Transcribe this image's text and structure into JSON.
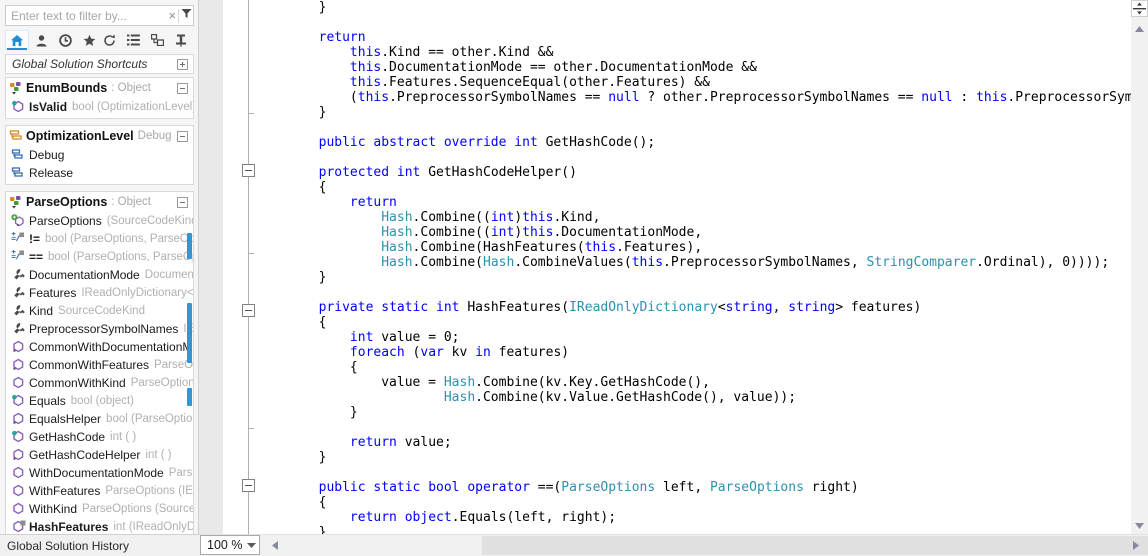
{
  "sidebar": {
    "filter": {
      "placeholder": "Enter text to filter by...",
      "value": "",
      "clear_glyph": "×"
    },
    "toolbar_left": [
      {
        "name": "home-icon",
        "label": "Home",
        "selected": true
      },
      {
        "name": "person-icon",
        "label": "Members",
        "selected": false
      },
      {
        "name": "clock-icon",
        "label": "Recent",
        "selected": false
      },
      {
        "name": "star-icon",
        "label": "Favorites",
        "selected": false
      }
    ],
    "toolbar_right": [
      {
        "name": "refresh-icon",
        "label": "Refresh"
      },
      {
        "name": "list-icon",
        "label": "List view"
      },
      {
        "name": "group-icon",
        "label": "Group by"
      },
      {
        "name": "pin-icon",
        "label": "Pin"
      }
    ],
    "section_header": {
      "title": "Global Solution Shortcuts",
      "expander": "plus"
    },
    "groups": [
      {
        "name": "EnumBounds",
        "type": ": Object",
        "icon": "enum-group-icon",
        "expander": "minus",
        "members": [
          {
            "icon": "method-key-icon",
            "name": "IsValid",
            "signature": "bool (OptimizationLevel)",
            "bold": true
          }
        ]
      },
      {
        "name": "OptimizationLevel",
        "type": "Debug",
        "icon": "enum-icon",
        "expander": "minus",
        "members": [
          {
            "icon": "enum-member-icon",
            "name": "Debug",
            "signature": "",
            "bold": false
          },
          {
            "icon": "enum-member-icon",
            "name": "Release",
            "signature": "",
            "bold": false
          }
        ]
      },
      {
        "name": "ParseOptions",
        "type": ": Object",
        "icon": "class-group-icon",
        "expander": "minus",
        "members": [
          {
            "icon": "ctor-icon",
            "name": "ParseOptions",
            "signature": "(SourceCodeKind, D",
            "bold": false
          },
          {
            "icon": "operator-icon",
            "name": "!=",
            "signature": "bool (ParseOptions, ParseOptions",
            "bold": true
          },
          {
            "icon": "operator-icon",
            "name": "==",
            "signature": "bool (ParseOptions, ParseOption",
            "bold": true
          },
          {
            "icon": "property-icon",
            "name": "DocumentationMode",
            "signature": "Document",
            "bold": false
          },
          {
            "icon": "property-icon",
            "name": "Features",
            "signature": "IReadOnlyDictionary<strin",
            "bold": false
          },
          {
            "icon": "property-icon",
            "name": "Kind",
            "signature": "SourceCodeKind",
            "bold": false
          },
          {
            "icon": "property-icon",
            "name": "PreprocessorSymbolNames",
            "signature": "IEnu",
            "bold": false
          },
          {
            "icon": "method-abstract-icon",
            "name": "CommonWithDocumentationM",
            "signature": "",
            "bold": false
          },
          {
            "icon": "method-abstract-icon",
            "name": "CommonWithFeatures",
            "signature": "ParseOpti",
            "bold": false
          },
          {
            "icon": "method-icon",
            "name": "CommonWithKind",
            "signature": "ParseOptions",
            "bold": false
          },
          {
            "icon": "method-key-icon",
            "name": "Equals",
            "signature": "bool (object)",
            "bold": false
          },
          {
            "icon": "method-abstract-icon",
            "name": "EqualsHelper",
            "signature": "bool (ParseOptions)",
            "bold": false
          },
          {
            "icon": "method-key-icon",
            "name": "GetHashCode",
            "signature": "int ( )",
            "bold": false
          },
          {
            "icon": "method-abstract-icon",
            "name": "GetHashCodeHelper",
            "signature": "int ( )",
            "bold": false
          },
          {
            "icon": "method-icon",
            "name": "WithDocumentationMode",
            "signature": "Parse",
            "bold": false
          },
          {
            "icon": "method-icon",
            "name": "WithFeatures",
            "signature": "ParseOptions (IEnum",
            "bold": false
          },
          {
            "icon": "method-icon",
            "name": "WithKind",
            "signature": "ParseOptions (SourceCod",
            "bold": false
          },
          {
            "icon": "method-static-icon",
            "name": "HashFeatures",
            "signature": "int (IReadOnlyDictio",
            "bold": true
          }
        ]
      }
    ],
    "status": "Global Solution History"
  },
  "editor": {
    "zoom": {
      "value": "100 %",
      "chevron": "▼"
    },
    "split_icon": "split-view-icon",
    "scroll_up_icon": "scroll-up-arrow-icon",
    "scroll_down_icon": "scroll-down-arrow-icon",
    "scroll_left_icon": "scroll-left-arrow-icon",
    "scroll_right_icon": "scroll-right-arrow-icon",
    "colors": {
      "keyword": "#0000ff",
      "type": "#2b91af",
      "text": "#000000",
      "accent": "#2f96dc"
    },
    "fold_boxes_y": [
      164,
      304,
      479
    ],
    "fold_ticks_y": [
      113,
      253,
      428
    ],
    "lines": [
      [
        {
          "t": "        }",
          "c": "op"
        }
      ],
      [],
      [
        {
          "t": "        ",
          "c": "op"
        },
        {
          "t": "return",
          "c": "kw"
        }
      ],
      [
        {
          "t": "            ",
          "c": "op"
        },
        {
          "t": "this",
          "c": "kw"
        },
        {
          "t": ".Kind == other.Kind &&",
          "c": "op"
        }
      ],
      [
        {
          "t": "            ",
          "c": "op"
        },
        {
          "t": "this",
          "c": "kw"
        },
        {
          "t": ".DocumentationMode == other.DocumentationMode &&",
          "c": "op"
        }
      ],
      [
        {
          "t": "            ",
          "c": "op"
        },
        {
          "t": "this",
          "c": "kw"
        },
        {
          "t": ".Features.SequenceEqual(other.Features) &&",
          "c": "op"
        }
      ],
      [
        {
          "t": "            (",
          "c": "op"
        },
        {
          "t": "this",
          "c": "kw"
        },
        {
          "t": ".PreprocessorSymbolNames == ",
          "c": "op"
        },
        {
          "t": "null",
          "c": "kw"
        },
        {
          "t": " ? other.PreprocessorSymbolNames == ",
          "c": "op"
        },
        {
          "t": "null",
          "c": "kw"
        },
        {
          "t": " : ",
          "c": "op"
        },
        {
          "t": "this",
          "c": "kw"
        },
        {
          "t": ".PreprocessorSymbolNames",
          "c": "op"
        }
      ],
      [
        {
          "t": "        }",
          "c": "op"
        }
      ],
      [],
      [
        {
          "t": "        ",
          "c": "op"
        },
        {
          "t": "public abstract override int",
          "c": "kw"
        },
        {
          "t": " GetHashCode();",
          "c": "op"
        }
      ],
      [],
      [
        {
          "t": "        ",
          "c": "op"
        },
        {
          "t": "protected int",
          "c": "kw"
        },
        {
          "t": " GetHashCodeHelper()",
          "c": "op"
        }
      ],
      [
        {
          "t": "        {",
          "c": "op"
        }
      ],
      [
        {
          "t": "            ",
          "c": "op"
        },
        {
          "t": "return",
          "c": "kw"
        }
      ],
      [
        {
          "t": "                ",
          "c": "op"
        },
        {
          "t": "Hash",
          "c": "ty"
        },
        {
          "t": ".Combine((",
          "c": "op"
        },
        {
          "t": "int",
          "c": "kw"
        },
        {
          "t": ")",
          "c": "op"
        },
        {
          "t": "this",
          "c": "kw"
        },
        {
          "t": ".Kind,",
          "c": "op"
        }
      ],
      [
        {
          "t": "                ",
          "c": "op"
        },
        {
          "t": "Hash",
          "c": "ty"
        },
        {
          "t": ".Combine((",
          "c": "op"
        },
        {
          "t": "int",
          "c": "kw"
        },
        {
          "t": ")",
          "c": "op"
        },
        {
          "t": "this",
          "c": "kw"
        },
        {
          "t": ".DocumentationMode,",
          "c": "op"
        }
      ],
      [
        {
          "t": "                ",
          "c": "op"
        },
        {
          "t": "Hash",
          "c": "ty"
        },
        {
          "t": ".Combine(HashFeatures(",
          "c": "op"
        },
        {
          "t": "this",
          "c": "kw"
        },
        {
          "t": ".Features),",
          "c": "op"
        }
      ],
      [
        {
          "t": "                ",
          "c": "op"
        },
        {
          "t": "Hash",
          "c": "ty"
        },
        {
          "t": ".Combine(",
          "c": "op"
        },
        {
          "t": "Hash",
          "c": "ty"
        },
        {
          "t": ".CombineValues(",
          "c": "op"
        },
        {
          "t": "this",
          "c": "kw"
        },
        {
          "t": ".PreprocessorSymbolNames, ",
          "c": "op"
        },
        {
          "t": "StringComparer",
          "c": "ty"
        },
        {
          "t": ".Ordinal), 0))));",
          "c": "op"
        }
      ],
      [
        {
          "t": "        }",
          "c": "op"
        }
      ],
      [],
      [
        {
          "t": "        ",
          "c": "op"
        },
        {
          "t": "private static int",
          "c": "kw"
        },
        {
          "t": " HashFeatures(",
          "c": "op"
        },
        {
          "t": "IReadOnlyDictionary",
          "c": "ty"
        },
        {
          "t": "<",
          "c": "op"
        },
        {
          "t": "string",
          "c": "kw"
        },
        {
          "t": ", ",
          "c": "op"
        },
        {
          "t": "string",
          "c": "kw"
        },
        {
          "t": "> features)",
          "c": "op"
        }
      ],
      [
        {
          "t": "        {",
          "c": "op"
        }
      ],
      [
        {
          "t": "            ",
          "c": "op"
        },
        {
          "t": "int",
          "c": "kw"
        },
        {
          "t": " value = 0;",
          "c": "op"
        }
      ],
      [
        {
          "t": "            ",
          "c": "op"
        },
        {
          "t": "foreach",
          "c": "kw"
        },
        {
          "t": " (",
          "c": "op"
        },
        {
          "t": "var",
          "c": "kw"
        },
        {
          "t": " kv ",
          "c": "op"
        },
        {
          "t": "in",
          "c": "kw"
        },
        {
          "t": " features)",
          "c": "op"
        }
      ],
      [
        {
          "t": "            {",
          "c": "op"
        }
      ],
      [
        {
          "t": "                value = ",
          "c": "op"
        },
        {
          "t": "Hash",
          "c": "ty"
        },
        {
          "t": ".Combine(kv.Key.GetHashCode(),",
          "c": "op"
        }
      ],
      [
        {
          "t": "                        ",
          "c": "op"
        },
        {
          "t": "Hash",
          "c": "ty"
        },
        {
          "t": ".Combine(kv.Value.GetHashCode(), value));",
          "c": "op"
        }
      ],
      [
        {
          "t": "            }",
          "c": "op"
        }
      ],
      [],
      [
        {
          "t": "            ",
          "c": "op"
        },
        {
          "t": "return",
          "c": "kw"
        },
        {
          "t": " value;",
          "c": "op"
        }
      ],
      [
        {
          "t": "        }",
          "c": "op"
        }
      ],
      [],
      [
        {
          "t": "        ",
          "c": "op"
        },
        {
          "t": "public static bool operator",
          "c": "kw"
        },
        {
          "t": " ==(",
          "c": "op"
        },
        {
          "t": "ParseOptions",
          "c": "ty"
        },
        {
          "t": " left, ",
          "c": "op"
        },
        {
          "t": "ParseOptions",
          "c": "ty"
        },
        {
          "t": " right)",
          "c": "op"
        }
      ],
      [
        {
          "t": "        {",
          "c": "op"
        }
      ],
      [
        {
          "t": "            ",
          "c": "op"
        },
        {
          "t": "return",
          "c": "kw"
        },
        {
          "t": " ",
          "c": "op"
        },
        {
          "t": "object",
          "c": "kw"
        },
        {
          "t": ".Equals(left, right);",
          "c": "op"
        }
      ],
      [
        {
          "t": "        }",
          "c": "op"
        }
      ]
    ]
  }
}
